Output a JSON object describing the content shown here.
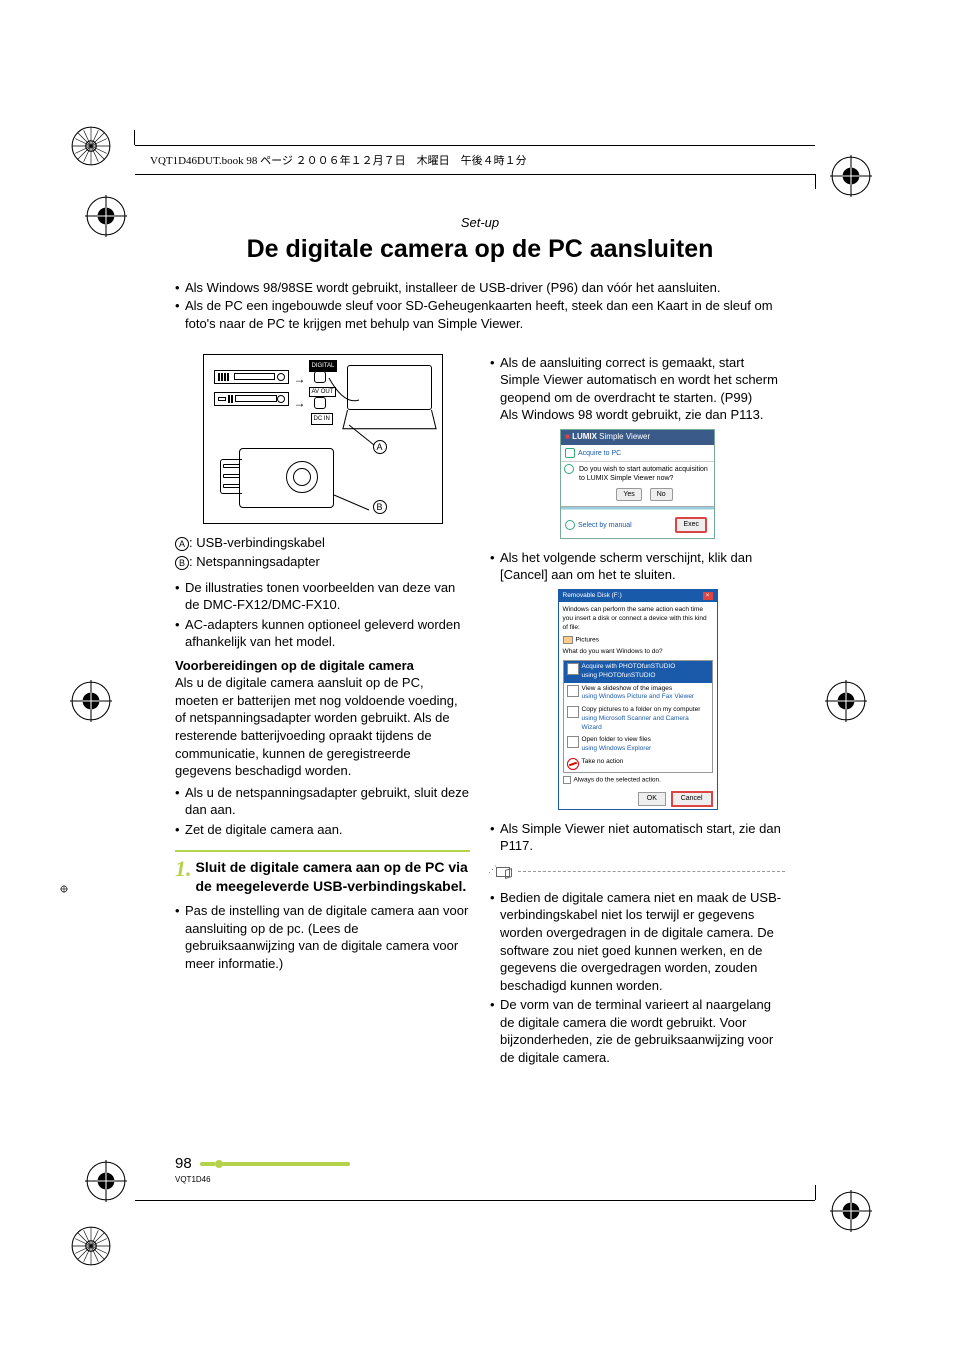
{
  "header_line": "VQT1D46DUT.book  98 ページ  ２００６年１２月７日　木曜日　午後４時１分",
  "section_label": "Set-up",
  "title": "De digitale camera op de PC aansluiten",
  "intro": [
    "Als Windows 98/98SE wordt gebruikt, installeer de USB-driver (P96) dan vóór het aansluiten.",
    "Als de PC een ingebouwde sleuf voor SD-Geheugenkaarten heeft, steek dan een Kaart in de sleuf om foto's naar de PC te krijgen met behulp van Simple Viewer."
  ],
  "diagram": {
    "label_digital": "DIGITAL",
    "label_avout": "AV OUT",
    "label_dcin": "DC IN",
    "callout_a": "A",
    "callout_b": "B"
  },
  "labels": {
    "a": "A",
    "a_text": ": USB-verbindingskabel",
    "b": "B",
    "b_text": ": Netspanningsadapter"
  },
  "left_bullets_1": [
    "De illustraties tonen voorbeelden van deze van de DMC-FX12/DMC-FX10.",
    "AC-adapters kunnen optioneel geleverd worden afhankelijk van het model."
  ],
  "prep_heading": "Voorbereidingen op de digitale camera",
  "prep_para": "Als u de digitale camera aansluit op de PC, moeten er batterijen met nog voldoende voeding, of netspanningsadapter worden gebruikt. Als de resterende batterijvoeding opraakt tijdens de communicatie, kunnen de geregistreerde gegevens beschadigd worden.",
  "left_bullets_2": [
    "Als u de netspanningsadapter gebruikt, sluit deze dan aan.",
    "Zet de digitale camera aan."
  ],
  "step": {
    "number": "1.",
    "title": "Sluit de digitale camera aan op de PC via de meegeleverde USB-verbindingskabel."
  },
  "step_bullets": [
    "Pas de instelling van de digitale camera aan voor aansluiting op de pc. (Lees de gebruiksaanwijzing van de digitale camera voor meer informatie.)"
  ],
  "right_para_1_bullet": "Als de aansluiting correct is gemaakt, start Simple Viewer automatisch en wordt het scherm geopend om de overdracht te starten. (P99)",
  "right_para_1_cont": "Als Windows 98 wordt gebruikt, zie dan P113.",
  "sv": {
    "title_lumix": "LUMIX",
    "title_rest": " Simple Viewer",
    "acquire": "Acquire to PC",
    "question": "Do you wish to start automatic acquisition to LUMIX Simple Viewer now?",
    "btn_yes": "Yes",
    "btn_no": "No",
    "select_manual": "Select by manual",
    "btn_exec": "Exec"
  },
  "right_bullet_2": "Als het volgende scherm verschijnt, klik dan [Cancel] aan om het te sluiten.",
  "win": {
    "title": "Removable Disk (F:)",
    "intro": "Windows can perform the same action each time you insert a disk or connect a device with this kind of file:",
    "pictures_label": "Pictures",
    "prompt": "What do you want Windows to do?",
    "item1_t": "Acquire with PHOTOfunSTUDIO",
    "item1_s": "using PHOTOfunSTUDIO",
    "item2_t": "View a slideshow of the images",
    "item2_s": "using Windows Picture and Fax Viewer",
    "item3_t": "Copy pictures to a folder on my computer",
    "item3_s": "using Microsoft Scanner and Camera Wizard",
    "item4_t": "Open folder to view files",
    "item4_s": "using Windows Explorer",
    "item5_t": "Take no action",
    "always": "Always do the selected action.",
    "ok": "OK",
    "cancel": "Cancel"
  },
  "right_bullet_3": "Als Simple Viewer niet automatisch start, zie dan P117.",
  "note_bullets": [
    "Bedien de digitale camera niet en maak de USB-verbindingskabel niet los terwijl er gegevens worden overgedragen in de digitale camera. De software zou niet goed kunnen werken, en de gegevens die overgedragen worden, zouden beschadigd kunnen worden.",
    "De vorm van de terminal varieert al naargelang de digitale camera die wordt gebruikt. Voor bijzonderheden, zie de gebruiksaanwijzing voor de digitale camera."
  ],
  "page_number": "98",
  "doc_code": "VQT1D46"
}
